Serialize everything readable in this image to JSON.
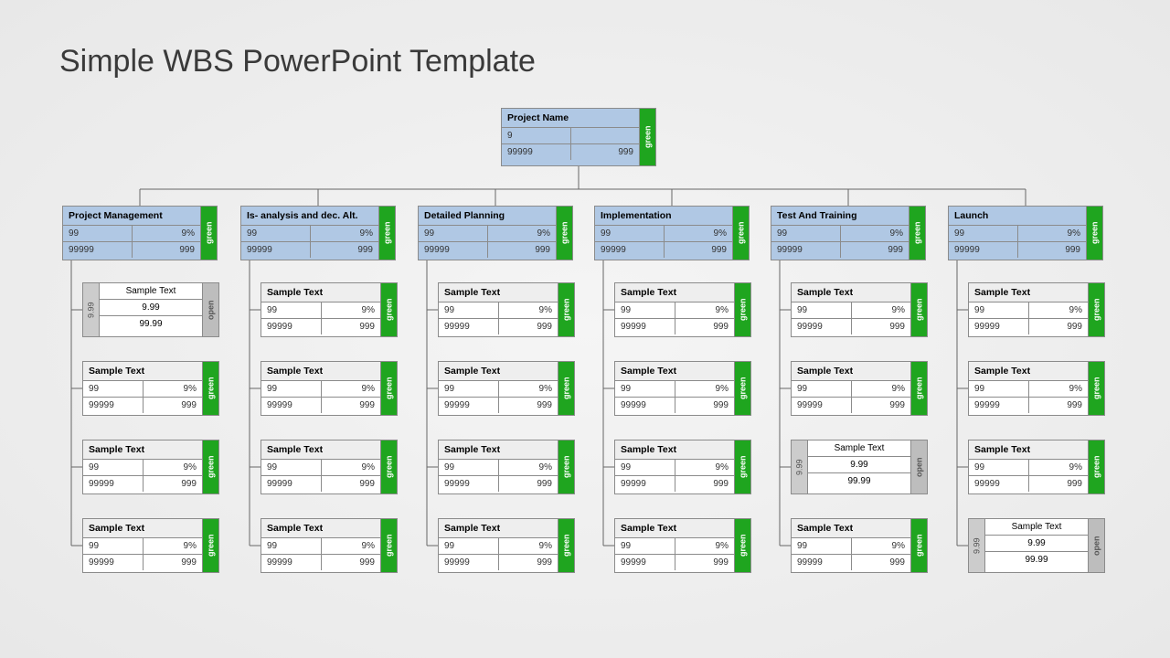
{
  "title": "Simple WBS PowerPoint Template",
  "tags": {
    "green": "green",
    "open": "open"
  },
  "root": {
    "name": "Project Name",
    "a": "9",
    "b": "",
    "c": "99999",
    "d": "999",
    "tag": "green"
  },
  "branches": [
    {
      "name": "Project Management",
      "a": "99",
      "b": "9%",
      "c": "99999",
      "d": "999",
      "tag": "green",
      "leaves": [
        {
          "kind": "open",
          "name": "Sample Text",
          "v1": "9.99",
          "v2": "99.99",
          "lt": "9.99",
          "tag": "open"
        },
        {
          "kind": "std",
          "name": "Sample Text",
          "a": "99",
          "b": "9%",
          "c": "99999",
          "d": "999",
          "tag": "green"
        },
        {
          "kind": "std",
          "name": "Sample Text",
          "a": "99",
          "b": "9%",
          "c": "99999",
          "d": "999",
          "tag": "green"
        },
        {
          "kind": "std",
          "name": "Sample Text",
          "a": "99",
          "b": "9%",
          "c": "99999",
          "d": "999",
          "tag": "green"
        }
      ]
    },
    {
      "name": "Is- analysis and dec. Alt.",
      "a": "99",
      "b": "9%",
      "c": "99999",
      "d": "999",
      "tag": "green",
      "leaves": [
        {
          "kind": "std",
          "name": "Sample Text",
          "a": "99",
          "b": "9%",
          "c": "99999",
          "d": "999",
          "tag": "green"
        },
        {
          "kind": "std",
          "name": "Sample Text",
          "a": "99",
          "b": "9%",
          "c": "99999",
          "d": "999",
          "tag": "green"
        },
        {
          "kind": "std",
          "name": "Sample Text",
          "a": "99",
          "b": "9%",
          "c": "99999",
          "d": "999",
          "tag": "green"
        },
        {
          "kind": "std",
          "name": "Sample Text",
          "a": "99",
          "b": "9%",
          "c": "99999",
          "d": "999",
          "tag": "green"
        }
      ]
    },
    {
      "name": "Detailed Planning",
      "a": "99",
      "b": "9%",
      "c": "99999",
      "d": "999",
      "tag": "green",
      "leaves": [
        {
          "kind": "std",
          "name": "Sample Text",
          "a": "99",
          "b": "9%",
          "c": "99999",
          "d": "999",
          "tag": "green"
        },
        {
          "kind": "std",
          "name": "Sample Text",
          "a": "99",
          "b": "9%",
          "c": "99999",
          "d": "999",
          "tag": "green"
        },
        {
          "kind": "std",
          "name": "Sample Text",
          "a": "99",
          "b": "9%",
          "c": "99999",
          "d": "999",
          "tag": "green"
        },
        {
          "kind": "std",
          "name": "Sample Text",
          "a": "99",
          "b": "9%",
          "c": "99999",
          "d": "999",
          "tag": "green"
        }
      ]
    },
    {
      "name": "Implementation",
      "a": "99",
      "b": "9%",
      "c": "99999",
      "d": "999",
      "tag": "green",
      "leaves": [
        {
          "kind": "std",
          "name": "Sample Text",
          "a": "99",
          "b": "9%",
          "c": "99999",
          "d": "999",
          "tag": "green"
        },
        {
          "kind": "std",
          "name": "Sample Text",
          "a": "99",
          "b": "9%",
          "c": "99999",
          "d": "999",
          "tag": "green"
        },
        {
          "kind": "std",
          "name": "Sample Text",
          "a": "99",
          "b": "9%",
          "c": "99999",
          "d": "999",
          "tag": "green"
        },
        {
          "kind": "std",
          "name": "Sample Text",
          "a": "99",
          "b": "9%",
          "c": "99999",
          "d": "999",
          "tag": "green"
        }
      ]
    },
    {
      "name": "Test And Training",
      "a": "99",
      "b": "9%",
      "c": "99999",
      "d": "999",
      "tag": "green",
      "leaves": [
        {
          "kind": "std",
          "name": "Sample Text",
          "a": "99",
          "b": "9%",
          "c": "99999",
          "d": "999",
          "tag": "green"
        },
        {
          "kind": "std",
          "name": "Sample Text",
          "a": "99",
          "b": "9%",
          "c": "99999",
          "d": "999",
          "tag": "green"
        },
        {
          "kind": "open",
          "name": "Sample Text",
          "v1": "9.99",
          "v2": "99.99",
          "lt": "9.99",
          "tag": "open"
        },
        {
          "kind": "std",
          "name": "Sample Text",
          "a": "99",
          "b": "9%",
          "c": "99999",
          "d": "999",
          "tag": "green"
        }
      ]
    },
    {
      "name": "Launch",
      "a": "99",
      "b": "9%",
      "c": "99999",
      "d": "999",
      "tag": "green",
      "leaves": [
        {
          "kind": "std",
          "name": "Sample Text",
          "a": "99",
          "b": "9%",
          "c": "99999",
          "d": "999",
          "tag": "green"
        },
        {
          "kind": "std",
          "name": "Sample Text",
          "a": "99",
          "b": "9%",
          "c": "99999",
          "d": "999",
          "tag": "green"
        },
        {
          "kind": "std",
          "name": "Sample Text",
          "a": "99",
          "b": "9%",
          "c": "99999",
          "d": "999",
          "tag": "green"
        },
        {
          "kind": "open",
          "name": "Sample Text",
          "v1": "9.99",
          "v2": "99.99",
          "lt": "9.99",
          "tag": "open"
        }
      ]
    }
  ]
}
